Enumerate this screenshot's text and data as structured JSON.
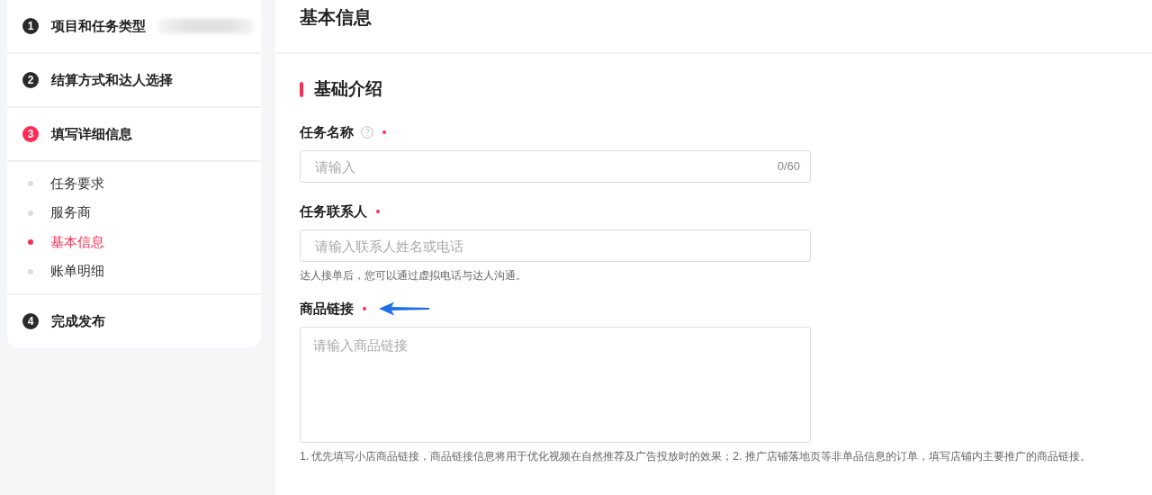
{
  "steps": [
    {
      "number": "1",
      "label": "项目和任务类型",
      "active": false
    },
    {
      "number": "2",
      "label": "结算方式和达人选择",
      "active": false
    },
    {
      "number": "3",
      "label": "填写详细信息",
      "active": true,
      "children": [
        {
          "label": "任务要求",
          "selected": false
        },
        {
          "label": "服务商",
          "selected": false
        },
        {
          "label": "基本信息",
          "selected": true
        },
        {
          "label": "账单明细",
          "selected": false
        }
      ]
    },
    {
      "number": "4",
      "label": "完成发布",
      "active": false
    }
  ],
  "page_title": "基本信息",
  "section": {
    "title": "基础介绍",
    "fields": [
      {
        "kind": "input",
        "label": "任务名称",
        "help": true,
        "required": true,
        "pointer": false,
        "placeholder": "请输入",
        "counter": "0/60"
      },
      {
        "kind": "input",
        "label": "任务联系人",
        "help": false,
        "required": true,
        "pointer": false,
        "placeholder": "请输入联系人姓名或电话",
        "hint": "达人接单后，您可以通过虚拟电话与达人沟通。"
      },
      {
        "kind": "textarea",
        "label": "商品链接",
        "help": false,
        "required": true,
        "pointer": true,
        "placeholder": "请输入商品链接",
        "hint": "1. 优先填写小店商品链接，商品链接信息将用于优化视频在自然推荐及广告投放时的效果；2. 推广店铺落地页等非单品信息的订单，填写店铺内主要推广的商品链接。"
      }
    ]
  }
}
